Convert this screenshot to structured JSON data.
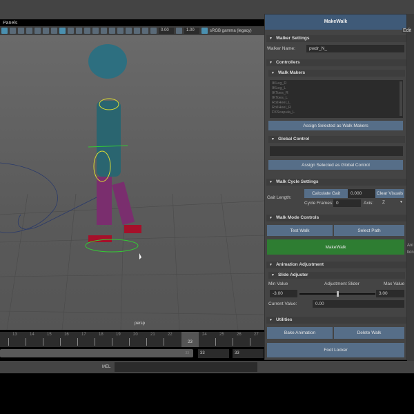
{
  "viewport": {
    "panels_menu": "Panels",
    "exposure": "0.00",
    "gamma": "1.00",
    "color_space": "sRGB gamma (legacy)",
    "camera": "persp"
  },
  "timeline": {
    "ticks": [
      "13",
      "14",
      "15",
      "16",
      "17",
      "18",
      "19",
      "20",
      "21",
      "22",
      "23",
      "24",
      "25",
      "26",
      "27"
    ],
    "current_frame": "23",
    "range_end": "33",
    "end_field_1": "33",
    "end_field_2": "33"
  },
  "command_line": {
    "label": "MEL"
  },
  "right_strip": {
    "menu": "Edit",
    "text1": "Ani",
    "text2": "tion"
  },
  "makewalk": {
    "title": "MakeWalk",
    "walker_settings": {
      "header": "Walker Settings",
      "name_label": "Walker Name:",
      "name_value": "pwdr_N_"
    },
    "controllers": {
      "header": "Controllers",
      "walk_makers": {
        "header": "Walk Makers",
        "items": [
          "IKLeg_R",
          "IKLeg_L",
          "IKToes_R",
          "IKToes_L",
          "RollHeel_L",
          "RollHeel_R",
          "FKScapula_L"
        ],
        "assign_button": "Assign Selected as Walk Makers"
      },
      "global_control": {
        "header": "Global Control",
        "value": "",
        "assign_button": "Assign Selected as Global Control"
      }
    },
    "walk_cycle": {
      "header": "Walk Cycle Settings",
      "gait_label": "Gait Length:",
      "calc_button": "Calculate Gait",
      "gait_value": "0.000",
      "clear_button": "Clear Visuals",
      "cycle_label": "Cycle Frames:",
      "cycle_value": "0",
      "axis_label": "Axis:",
      "axis_value": "Z"
    },
    "walk_mode": {
      "header": "Walk Mode Controls",
      "test_button": "Test Walk",
      "select_button": "Select Path",
      "makewalk_button": "MakeWalk"
    },
    "animation_adjustment": {
      "header": "Animation Adjustment",
      "slide_header": "Slide Adjuster",
      "min_label": "Min Value",
      "slider_label": "Adjustment Slider",
      "max_label": "Max Value",
      "min_value": "-3.00",
      "max_value": "3.00",
      "current_label": "Current Value:",
      "current_value": "0.00",
      "slider_fraction": 0.5
    },
    "utilities": {
      "header": "Utilities",
      "bake_button": "Bake Animation",
      "delete_button": "Delete Walk",
      "foot_button": "Foot Locker"
    }
  },
  "colors": {
    "button": "#566e88",
    "makewalk": "#2e7d32",
    "title": "#3f5a78"
  }
}
